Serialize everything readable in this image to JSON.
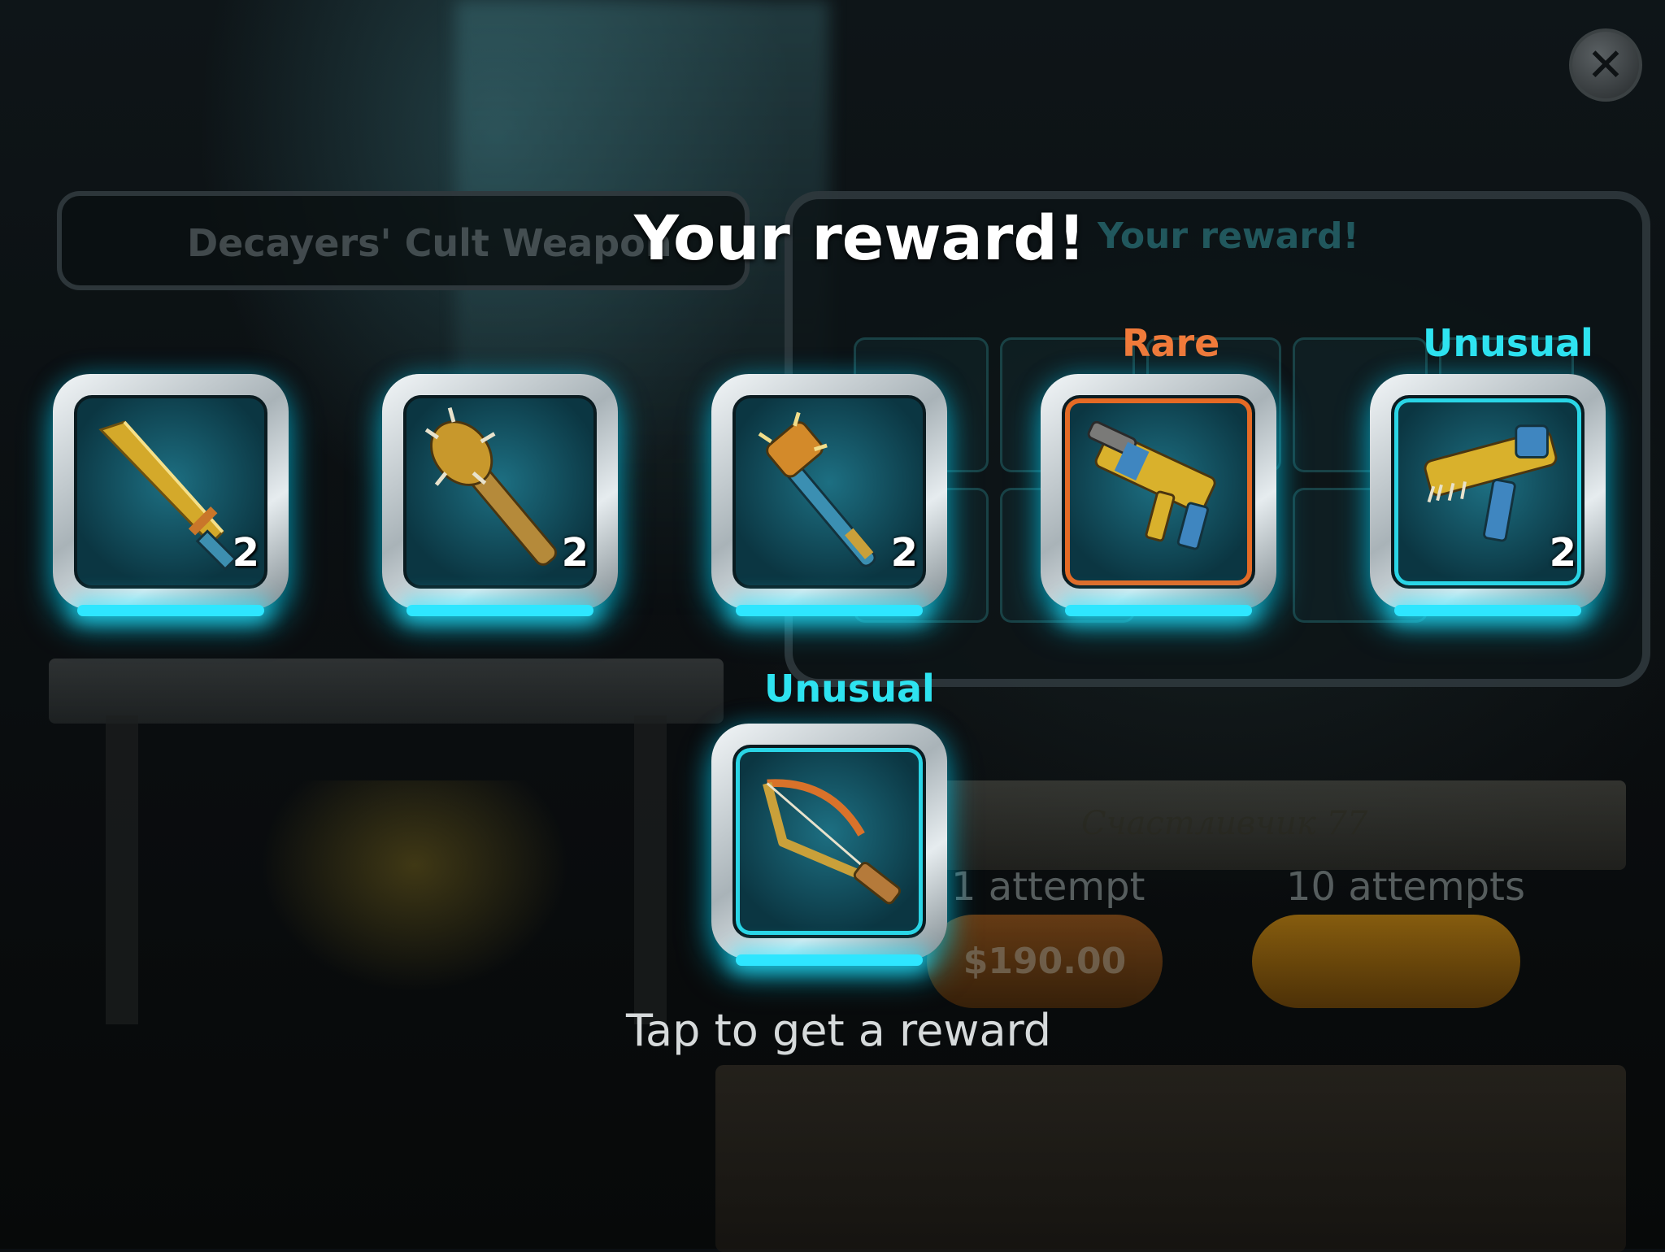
{
  "background": {
    "left_panel_title": "Decayers' Cult Weapon",
    "right_panel_title": "Your reward!",
    "crate_script": "Счастливчик 77",
    "attempt_one_label": "1 attempt",
    "attempt_ten_label": "10 attempts",
    "price": "$190.00"
  },
  "title": "Your reward!",
  "rewards": [
    {
      "weapon": "machete",
      "count": "2",
      "rarity": ""
    },
    {
      "weapon": "spiked-club",
      "count": "2",
      "rarity": ""
    },
    {
      "weapon": "spiked-mace",
      "count": "2",
      "rarity": ""
    },
    {
      "weapon": "submachine-gun",
      "count": "",
      "rarity": "Rare"
    },
    {
      "weapon": "spiked-pistol",
      "count": "2",
      "rarity": "Unusual"
    },
    {
      "weapon": "crossbow",
      "count": "",
      "rarity": "Unusual"
    }
  ],
  "hint": "Tap to get a reward",
  "colors": {
    "rare": "#f07a3a",
    "unusual": "#2ee3f0",
    "glow": "#2ee6ff"
  }
}
